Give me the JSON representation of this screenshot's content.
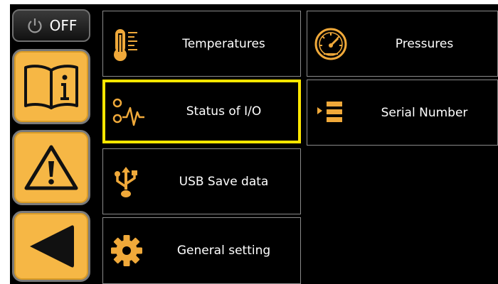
{
  "power": {
    "label": "OFF",
    "icon": "power-icon"
  },
  "side_buttons": [
    {
      "name": "manual-info",
      "icon": "book-info-icon"
    },
    {
      "name": "alarms",
      "icon": "warning-icon"
    },
    {
      "name": "back",
      "icon": "back-arrow-icon"
    }
  ],
  "tiles": [
    {
      "label": "Temperatures",
      "icon": "thermometer-icon",
      "selected": false
    },
    {
      "label": "Pressures",
      "icon": "gauge-icon",
      "selected": false
    },
    {
      "label": "Status of I/O",
      "icon": "io-signal-icon",
      "selected": true
    },
    {
      "label": "Serial Number",
      "icon": "list-icon",
      "selected": false
    },
    {
      "label": "USB Save data",
      "icon": "usb-icon",
      "selected": false
    },
    {
      "label": "General setting",
      "icon": "gear-icon",
      "selected": false
    }
  ],
  "colors": {
    "accent": "#f6b745",
    "selection": "#ffe600",
    "background": "#000000",
    "border": "#8a8a8a"
  }
}
